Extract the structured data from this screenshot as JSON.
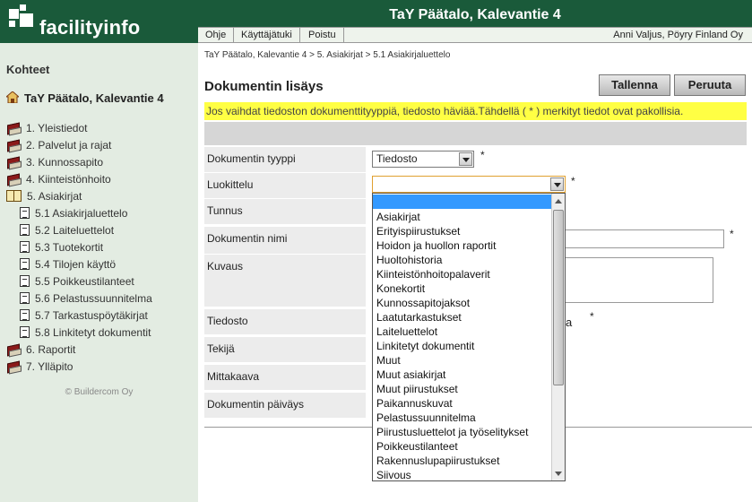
{
  "header": {
    "brand": "facilityinfo",
    "title": "TaY Päätalo, Kalevantie 4",
    "menu": [
      "Ohje",
      "Käyttäjätuki",
      "Poistu"
    ],
    "user": "Anni Valjus, Pöyry Finland Oy"
  },
  "sidebar": {
    "heading": "Kohteet",
    "site": "TaY Päätalo, Kalevantie 4",
    "items": [
      {
        "label": "1. Yleistiedot",
        "icon": "book-icon"
      },
      {
        "label": "2. Palvelut ja rajat",
        "icon": "book-icon"
      },
      {
        "label": "3. Kunnossapito",
        "icon": "book-icon"
      },
      {
        "label": "4. Kiinteistönhoito",
        "icon": "book-icon"
      },
      {
        "label": "5. Asiakirjat",
        "icon": "open-book-icon"
      },
      {
        "label": "5.1 Asiakirjaluettelo",
        "icon": "document-icon"
      },
      {
        "label": "5.2 Laiteluettelot",
        "icon": "document-icon"
      },
      {
        "label": "5.3 Tuotekortit",
        "icon": "document-icon"
      },
      {
        "label": "5.4 Tilojen käyttö",
        "icon": "document-icon"
      },
      {
        "label": "5.5 Poikkeustilanteet",
        "icon": "document-icon"
      },
      {
        "label": "5.6 Pelastussuunnitelma",
        "icon": "document-icon"
      },
      {
        "label": "5.7 Tarkastuspöytäkirjat",
        "icon": "document-icon"
      },
      {
        "label": "5.8 Linkitetyt dokumentit",
        "icon": "document-icon"
      },
      {
        "label": "6. Raportit",
        "icon": "book-icon"
      },
      {
        "label": "7. Ylläpito",
        "icon": "book-icon"
      }
    ],
    "copyright": "© Buildercom Oy"
  },
  "main": {
    "breadcrumb": "TaY Päätalo, Kalevantie 4 > 5. Asiakirjat > 5.1 Asiakirjaluettelo",
    "title": "Dokumentin lisäys",
    "save_label": "Tallenna",
    "cancel_label": "Peruuta",
    "warning": "Jos vaihdat tiedoston dokumenttityyppiä, tiedosto häviää.Tähdellä ( * ) merkityt tiedot ovat pakollisia.",
    "required_mark": "*",
    "fields": {
      "type_label": "Dokumentin tyyppi",
      "type_value": "Tiedosto",
      "class_label": "Luokittelu",
      "class_value": "",
      "id_label": "Tunnus",
      "name_label": "Dokumentin nimi",
      "desc_label": "Kuvaus",
      "file_label": "Tiedosto",
      "file_suffix": "a",
      "author_label": "Tekijä",
      "scale_label": "Mittakaava",
      "date_label": "Dokumentin päiväys"
    },
    "class_options": [
      "Asiakirjat",
      "Erityispiirustukset",
      "Hoidon ja huollon raportit",
      "Huoltohistoria",
      "Kiinteistönhoitopalaverit",
      "Konekortit",
      "Kunnossapitojaksot",
      "Laatutarkastukset",
      "Laiteluettelot",
      "Linkitetyt dokumentit",
      "Muut",
      "Muut asiakirjat",
      "Muut piirustukset",
      "Paikannuskuvat",
      "Pelastussuunnitelma",
      "Piirustusluettelot ja työselitykset",
      "Poikkeustilanteet",
      "Rakennuslupapiirustukset",
      "Siivous"
    ]
  },
  "colors": {
    "brand_green": "#1a5a3a",
    "sidebar_bg": "#e3ece2",
    "warning_bg": "#ffff44",
    "selection_blue": "#3399ff"
  }
}
